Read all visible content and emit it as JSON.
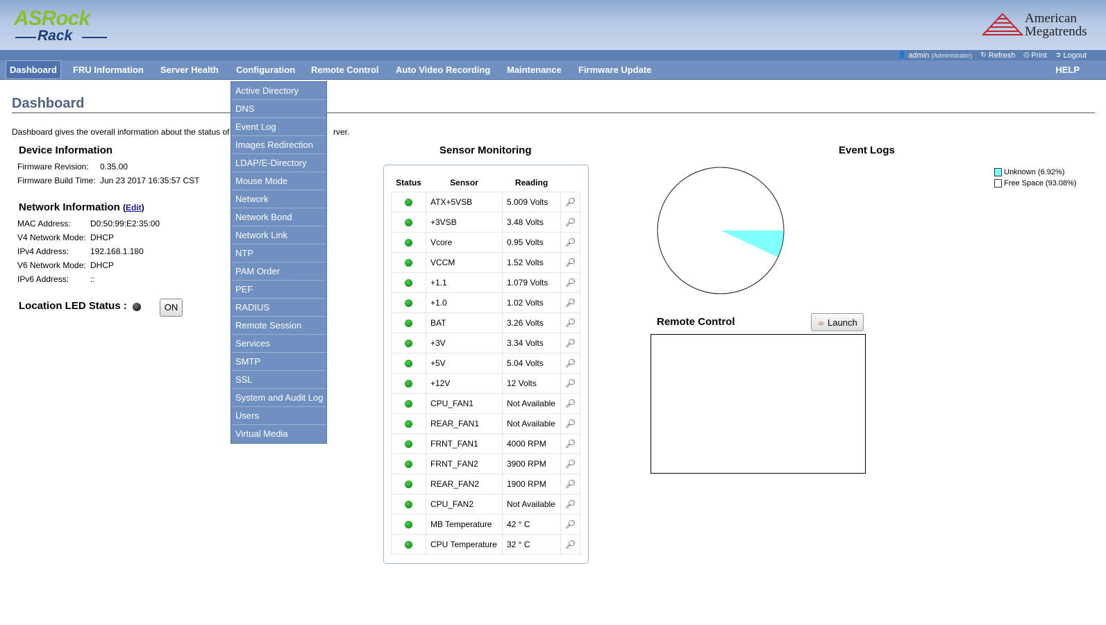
{
  "header": {
    "logo_top": "ASRock",
    "logo_bottom": "Rack",
    "vendor_line1": "American",
    "vendor_line2": "Megatrends"
  },
  "toolstrip": {
    "user": "admin",
    "role": "(Administrator)",
    "refresh": "Refresh",
    "print": "Print",
    "logout": "Logout"
  },
  "nav": {
    "items": [
      "Dashboard",
      "FRU Information",
      "Server Health",
      "Configuration",
      "Remote Control",
      "Auto Video Recording",
      "Maintenance",
      "Firmware Update"
    ],
    "help": "HELP"
  },
  "config_menu": [
    "Active Directory",
    "DNS",
    "Event Log",
    "Images Redirection",
    "LDAP/E-Directory",
    "Mouse Mode",
    "Network",
    "Network Bond",
    "Network Link",
    "NTP",
    "PAM Order",
    "PEF",
    "RADIUS",
    "Remote Session",
    "Services",
    "SMTP",
    "SSL",
    "System and Audit Log",
    "Users",
    "Virtual Media"
  ],
  "page": {
    "title": "Dashboard",
    "description_start": "Dashboard gives the overall information about the status of",
    "description_end": "rver."
  },
  "device": {
    "heading": "Device Information",
    "fw_rev_label": "Firmware Revision:",
    "fw_rev": "0.35.00",
    "fw_build_label": "Firmware Build Time:",
    "fw_build": "Jun 23 2017 16:35:57 CST"
  },
  "network": {
    "heading": "Network Information",
    "edit": "Edit",
    "mac_label": "MAC Address:",
    "mac": "D0:50:99:E2:35:00",
    "v4mode_label": "V4 Network Mode:",
    "v4mode": "DHCP",
    "ipv4_label": "IPv4 Address:",
    "ipv4": "192.168.1.180",
    "v6mode_label": "V6 Network Mode:",
    "v6mode": "DHCP",
    "ipv6_label": "IPv6 Address:",
    "ipv6": "::"
  },
  "led": {
    "label": "Location LED Status :",
    "button": "ON"
  },
  "sensors": {
    "heading": "Sensor Monitoring",
    "columns": [
      "Status",
      "Sensor",
      "Reading"
    ],
    "rows": [
      {
        "name": "ATX+5VSB",
        "reading": "5.009 Volts"
      },
      {
        "name": "+3VSB",
        "reading": "3.48 Volts"
      },
      {
        "name": "Vcore",
        "reading": "0.95 Volts"
      },
      {
        "name": "VCCM",
        "reading": "1.52 Volts"
      },
      {
        "name": "+1.1",
        "reading": "1.079 Volts"
      },
      {
        "name": "+1.0",
        "reading": "1.02 Volts"
      },
      {
        "name": "BAT",
        "reading": "3.26 Volts"
      },
      {
        "name": "+3V",
        "reading": "3.34 Volts"
      },
      {
        "name": "+5V",
        "reading": "5.04 Volts"
      },
      {
        "name": "+12V",
        "reading": "12 Volts"
      },
      {
        "name": "CPU_FAN1",
        "reading": "Not Available"
      },
      {
        "name": "REAR_FAN1",
        "reading": "Not Available"
      },
      {
        "name": "FRNT_FAN1",
        "reading": "4000 RPM"
      },
      {
        "name": "FRNT_FAN2",
        "reading": "3900 RPM"
      },
      {
        "name": "REAR_FAN2",
        "reading": "1900 RPM"
      },
      {
        "name": "CPU_FAN2",
        "reading": "Not Available"
      },
      {
        "name": "MB Temperature",
        "reading": "42 ° C"
      },
      {
        "name": "CPU Temperature",
        "reading": "32 ° C"
      }
    ]
  },
  "event_logs": {
    "heading": "Event Logs",
    "slices": [
      {
        "label": "Unknown (6.92%)",
        "percent": 6.92,
        "color": "#80ffff"
      },
      {
        "label": "Free Space (93.08%)",
        "percent": 93.08,
        "color": "#ffffff"
      }
    ]
  },
  "remote_control": {
    "heading": "Remote Control",
    "launch": "Launch"
  }
}
